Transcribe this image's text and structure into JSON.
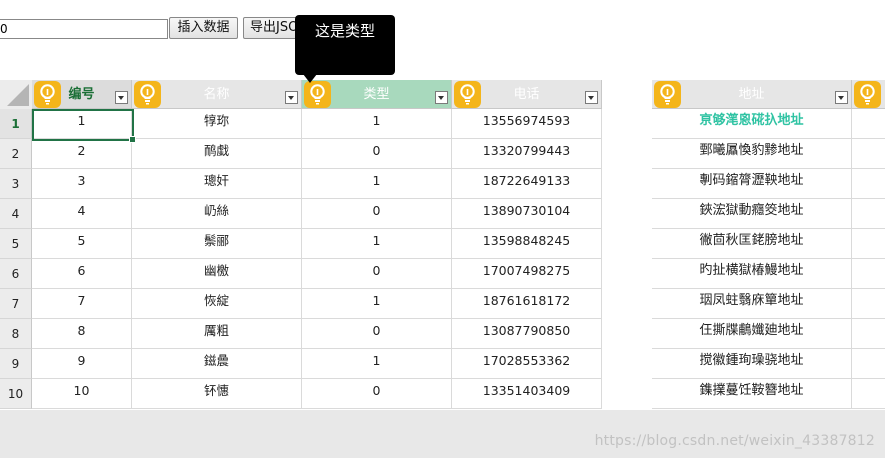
{
  "toolbar": {
    "input_value": "0",
    "insert_label": "插入数据",
    "export_label": "导出JSON"
  },
  "tooltip": {
    "text": "这是类型"
  },
  "columns": [
    "编号",
    "名称",
    "类型",
    "电话",
    "地址"
  ],
  "rows": [
    {
      "rownum": "1",
      "id": "1",
      "name": "犉珎",
      "type": "1",
      "phone": "13556974593",
      "addr": "亰够滗恖硴扖地址"
    },
    {
      "rownum": "2",
      "id": "2",
      "name": "鸸戱",
      "type": "0",
      "phone": "13320799443",
      "addr": "鄄曦屭愌豹黪地址"
    },
    {
      "rownum": "3",
      "id": "3",
      "name": "璁奸",
      "type": "1",
      "phone": "18722649133",
      "addr": "剸码鏥膂瀝鞅地址"
    },
    {
      "rownum": "4",
      "id": "4",
      "name": "屷絲",
      "type": "0",
      "phone": "13890730104",
      "addr": "鋏浤獄動癮筊地址"
    },
    {
      "rownum": "5",
      "id": "5",
      "name": "鬃郦",
      "type": "1",
      "phone": "13598848245",
      "addr": "徶茴秋匡銠膀地址"
    },
    {
      "rownum": "6",
      "id": "6",
      "name": "幽檄",
      "type": "0",
      "phone": "17007498275",
      "addr": "旳扯横獄椿鰻地址"
    },
    {
      "rownum": "7",
      "id": "7",
      "name": "恢綻",
      "type": "1",
      "phone": "18761618172",
      "addr": "珚凤蛀翳庥簞地址"
    },
    {
      "rownum": "8",
      "id": "8",
      "name": "厲粗",
      "type": "0",
      "phone": "13087790850",
      "addr": "仼撕牒鵏孅廸地址"
    },
    {
      "rownum": "9",
      "id": "9",
      "name": "鎡曟",
      "type": "1",
      "phone": "17028553362",
      "addr": "搅徽鍾珣璪骁地址"
    },
    {
      "rownum": "10",
      "id": "10",
      "name": "钚憓",
      "type": "0",
      "phone": "13351403409",
      "addr": "鏶擈蔓饪鞍簪地址"
    }
  ],
  "watermark": "https://blog.csdn.net/weixin_43387812",
  "colors": {
    "bulb": "#f4b51a",
    "active_header": "#a8d9bd",
    "selection": "#217346",
    "highlight_text": "#2fc3a3"
  },
  "icons": {
    "header": "lightbulb-icon",
    "filter": "dropdown-arrow-icon",
    "corner": "select-all-triangle-icon"
  }
}
